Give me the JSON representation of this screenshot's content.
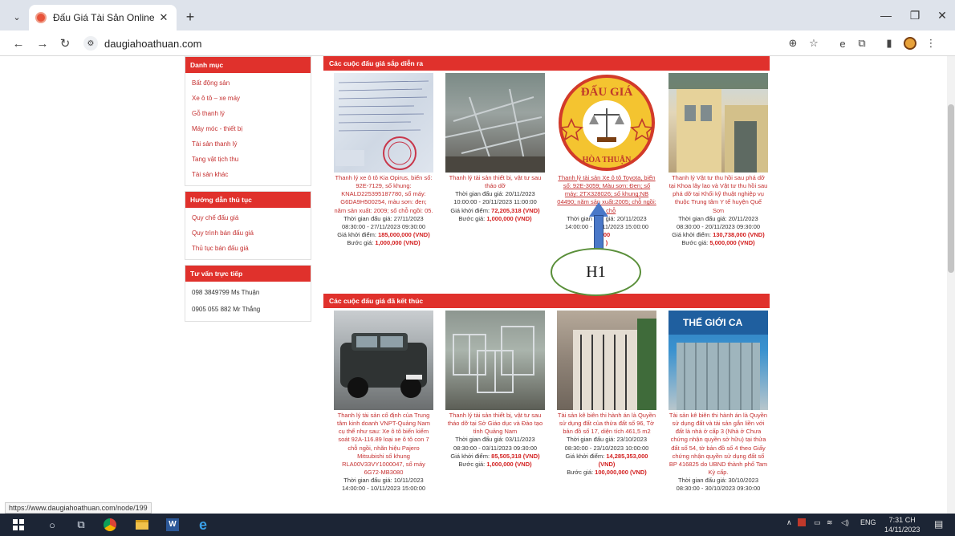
{
  "browser": {
    "tab_title": "Đấu Giá Tài Sản Online |",
    "url": "daugiahoathuan.com",
    "status_url": "https://www.daugiahoathuan.com/node/199"
  },
  "sidebar": {
    "categories_title": "Danh mục",
    "categories": [
      "Bất động sản",
      "Xe ô tô – xe máy",
      "Gỗ thanh lý",
      "Máy móc - thiết bị",
      "Tài sản thanh lý",
      "Tang vật tịch thu",
      "Tài sản khác"
    ],
    "guide_title": "Hướng dẫn thủ tục",
    "guides": [
      "Quy chế đấu giá",
      "Quy trình bán đấu giá",
      "Thủ tục bán đấu giá"
    ],
    "consult_title": "Tư vấn trực tiếp",
    "contacts": [
      "098 3849799 Ms Thuận",
      "0905 055 882 Mr Thắng"
    ]
  },
  "upcoming": {
    "title": "Các cuộc đấu giá sắp diễn ra",
    "items": [
      {
        "title": "Thanh lý xe ô tô Kia Opirus, biển số: 92E-7129, số khung: KNALD225395187780, số máy: G6DA9H500254, màu sơn: đen; năm sản xuất: 2009; số chỗ ngồi: 05.",
        "time_label": "Thời gian đấu giá: 27/11/2023 08:30:00 - 27/11/2023 09:30:00",
        "start_label": "Giá khởi điểm:",
        "start_value": "185,000,000 (VND)",
        "step_label": "Bước giá:",
        "step_value": "1,000,000 (VND)"
      },
      {
        "title": "Thanh lý tài sản thiết bị, vật tư sau tháo dỡ",
        "time_label": "Thời gian đấu giá: 20/11/2023 10:00:00 - 20/11/2023 11:00:00",
        "start_label": "Giá khởi điểm:",
        "start_value": "72,205,318 (VND)",
        "step_label": "Bước giá:",
        "step_value": "1,000,000 (VND)"
      },
      {
        "title": "Thanh lý tài sản Xe ô tô Toyota, biển số: 92E-3059; Màu sơn: Đen; số máy: 2TX328026; số khung:NB 04490; năm sản xuất:2005; chỗ ngồi: 05 chỗ",
        "time_label": "Thời gian đấu giá: 20/11/2023 14:00:00 - 20/11/2023 15:00:00",
        "start_label": "",
        "start_value": "00",
        "step_label": "",
        "step_value": ")"
      },
      {
        "title": "Thanh lý Vật tư thu hồi sau phá dỡ tại Khoa lây lao và Vật tư thu hồi sau phá dỡ tại Khối kỹ thuật nghiệp vụ thuộc Trung tâm Y tế huyện Quế Sơn",
        "time_label": "Thời gian đấu giá: 20/11/2023 08:30:00 - 20/11/2023 09:30:00",
        "start_label": "Giá khởi điểm:",
        "start_value": "130,738,000 (VND)",
        "step_label": "Bước giá:",
        "step_value": "5,000,000 (VND)"
      }
    ]
  },
  "finished": {
    "title": "Các cuộc đấu giá đã kết thúc",
    "items": [
      {
        "title": "Thanh lý tài sản cố định của Trung tâm kinh doanh VNPT-Quảng Nam cụ thể như sau: Xe ô tô biển kiểm soát 92A-116.89 loại xe ô tô con 7 chỗ ngồi, nhãn hiệu Pajero Mitsubishi số khung RLA00V33VY1000047, số máy 6G72-MB3080",
        "time_label": "Thời gian đấu giá: 10/11/2023 14:00:00 - 10/11/2023 15:00:00"
      },
      {
        "title": "Thanh lý tài sản thiết bị, vật tư sau tháo dỡ tại Sở Giáo dục và Đào tạo tỉnh Quảng Nam",
        "time_label": "Thời gian đấu giá: 03/11/2023 08:30:00 - 03/11/2023 09:30:00",
        "start_label": "Giá khởi điểm:",
        "start_value": "85,505,318 (VND)",
        "step_label": "Bước giá:",
        "step_value": "1,000,000 (VND)"
      },
      {
        "title": "Tài sản kê biên thi hành án là Quyền sử dụng đất của thửa đất số 96, Tờ bản đồ số 17, diện tích 461,5 m2",
        "time_label": "Thời gian đấu giá: 23/10/2023 08:30:00 - 23/10/2023 10:00:00",
        "start_label": "Giá khởi điểm:",
        "start_value": "14,285,353,000 (VND)",
        "step_label": "Bước giá:",
        "step_value": "100,000,000 (VND)"
      },
      {
        "title": "Tài sản kê biên thi hành án là Quyền sử dụng đất và tài sản gắn liền với đất là nhà ở cấp 3 (Nhà ở Chưa chứng nhận quyền sở hữu) tại thửa đất số 54, tờ bản đồ số 4 theo Giấy chứng nhận quyền sử dụng đất số BP 416825 do UBND thành phố Tam Kỳ cấp.",
        "time_label": "Thời gian đấu giá: 30/10/2023 08:30:00 - 30/10/2023 09:30:00"
      }
    ]
  },
  "logo": {
    "top_text": "ĐẤU GIÁ",
    "bottom_text": "HÒA THUẬN"
  },
  "shop_sign": "THẾ GIỚI CA",
  "annotation": {
    "label": "H1"
  },
  "taskbar": {
    "lang": "ENG",
    "time": "7:31 CH",
    "date": "14/11/2023"
  }
}
